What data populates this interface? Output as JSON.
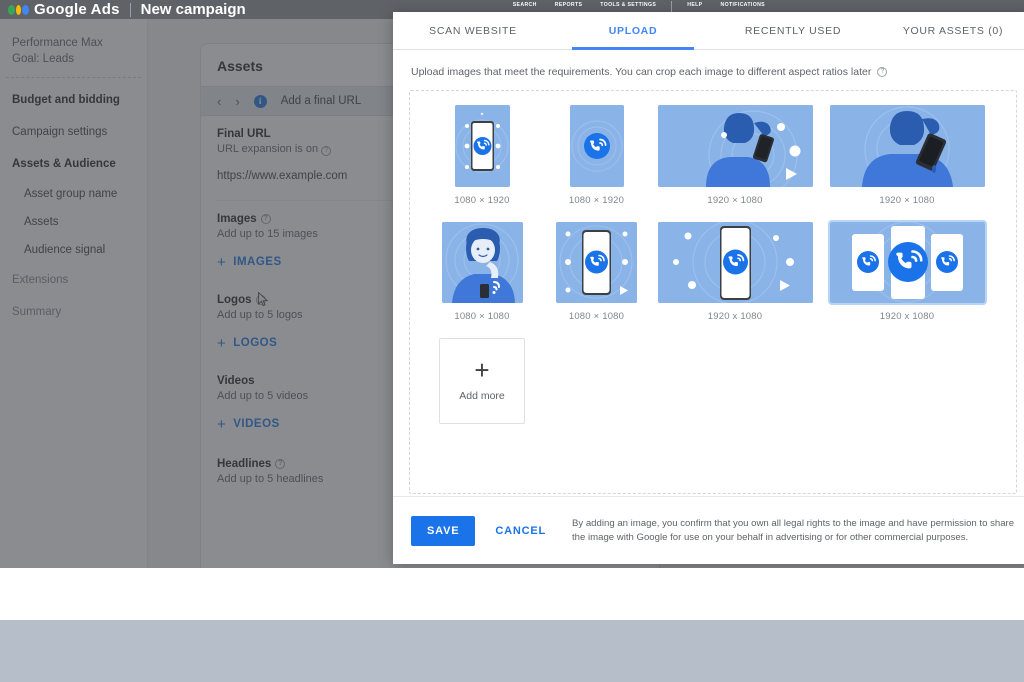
{
  "topbar": {
    "brand": "Google Ads",
    "page_title": "New campaign",
    "nav": [
      "SEARCH",
      "REPORTS",
      "TOOLS & SETTINGS",
      "HELP",
      "NOTIFICATIONS"
    ]
  },
  "sidebar": {
    "header_line1": "Performance Max",
    "header_line2": "Goal: Leads",
    "items": [
      {
        "label": "Budget and bidding",
        "style": "bold"
      },
      {
        "label": "Campaign settings",
        "style": "normal"
      },
      {
        "label": "Assets & Audience",
        "style": "bold"
      }
    ],
    "sub_items": [
      {
        "label": "Asset group name"
      },
      {
        "label": "Assets"
      },
      {
        "label": "Audience signal"
      }
    ],
    "tail_items": [
      {
        "label": "Extensions",
        "style": "muted"
      },
      {
        "label": "Summary",
        "style": "muted"
      }
    ]
  },
  "assets_panel": {
    "title": "Assets",
    "final_url_bar": {
      "prev": "‹",
      "next": "›",
      "info": "i",
      "text": "Add a final URL"
    },
    "final_url": {
      "label": "Final URL",
      "sub": "URL expansion is on",
      "value": "https://www.example.com"
    },
    "sections": [
      {
        "label": "Images",
        "sub": "Add up to 15 images",
        "action": "IMAGES"
      },
      {
        "label": "Logos",
        "sub": "Add up to 5 logos",
        "action": "LOGOS"
      },
      {
        "label": "Videos",
        "sub": "Add up to 5 videos",
        "action": "VIDEOS"
      },
      {
        "label": "Headlines",
        "sub": "Add up to 5 headlines",
        "action": ""
      }
    ]
  },
  "modal": {
    "tabs": [
      {
        "label": "SCAN WEBSITE",
        "active": false
      },
      {
        "label": "UPLOAD",
        "active": true
      },
      {
        "label": "RECENTLY USED",
        "active": false
      },
      {
        "label": "YOUR ASSETS (0)",
        "active": false
      }
    ],
    "note": "Upload images that meet the requirements. You can crop each image to different aspect ratios later",
    "note_icon": "help-icon",
    "thumbnails": [
      {
        "dimensions": "1080 × 1920",
        "orientation": "portrait",
        "art": "phone-in-frame"
      },
      {
        "dimensions": "1080 × 1920",
        "orientation": "portrait",
        "art": "call-badge"
      },
      {
        "dimensions": "1920 × 1080",
        "orientation": "landscape",
        "art": "person-phone-left"
      },
      {
        "dimensions": "1920 × 1080",
        "orientation": "landscape",
        "art": "person-phone-center"
      },
      {
        "dimensions": "1080 × 1080",
        "orientation": "square",
        "art": "woman-phone"
      },
      {
        "dimensions": "1080 × 1080",
        "orientation": "square",
        "art": "phone-call-square"
      },
      {
        "dimensions": "1920 x 1080",
        "orientation": "landscape",
        "art": "phone-call-wide"
      },
      {
        "dimensions": "1920 x 1080",
        "orientation": "landscape",
        "art": "three-phones"
      }
    ],
    "add_more": {
      "label": "Add more",
      "icon": "plus-icon"
    },
    "footer": {
      "save_label": "SAVE",
      "cancel_label": "CANCEL",
      "legal": "By adding an image, you confirm that you own all legal rights to the image and have permission to share the image with Google for use on your behalf in advertising or for other commercial purposes."
    }
  },
  "colors": {
    "accent": "#1a73e8",
    "tab_active": "#4285f4",
    "topbar": "#5f6368",
    "thumb_bg": "#8ab4e8",
    "bottom_band": "#b6bec9"
  }
}
